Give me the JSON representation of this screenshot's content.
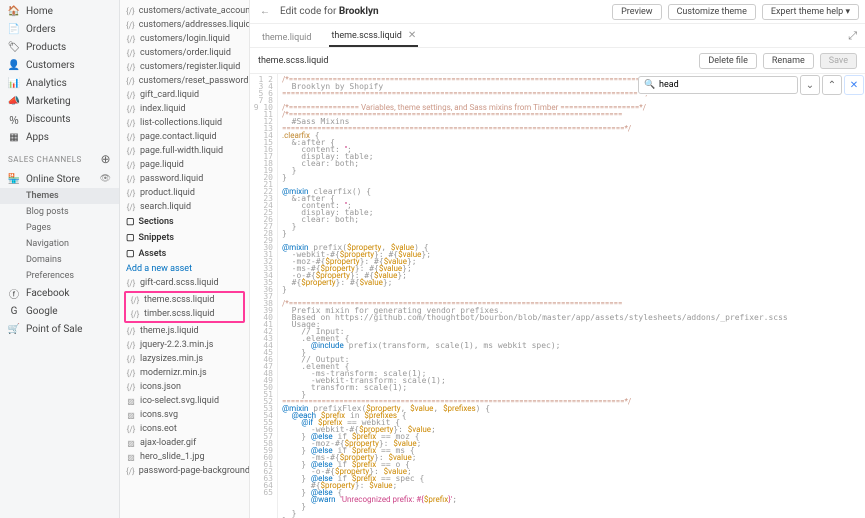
{
  "topbar": {
    "title_prefix": "Edit code for ",
    "title_store": "Brooklyn",
    "preview": "Preview",
    "customize": "Customize theme",
    "expert_help": "Expert theme help"
  },
  "nav": {
    "main": [
      {
        "icon": "home",
        "label": "Home"
      },
      {
        "icon": "orders",
        "label": "Orders"
      },
      {
        "icon": "products",
        "label": "Products"
      },
      {
        "icon": "customers",
        "label": "Customers"
      },
      {
        "icon": "analytics",
        "label": "Analytics"
      },
      {
        "icon": "marketing",
        "label": "Marketing"
      },
      {
        "icon": "discounts",
        "label": "Discounts"
      },
      {
        "icon": "apps",
        "label": "Apps"
      }
    ],
    "channels_head": "SALES CHANNELS",
    "online_store": "Online Store",
    "online_sub": [
      "Themes",
      "Blog posts",
      "Pages",
      "Navigation",
      "Domains",
      "Preferences"
    ],
    "extra": [
      {
        "icon": "fb",
        "label": "Facebook"
      },
      {
        "icon": "google",
        "label": "Google"
      },
      {
        "icon": "pos",
        "label": "Point of Sale"
      }
    ]
  },
  "tree": {
    "top_files": [
      "customers/activate_account...",
      "customers/addresses.liquid",
      "customers/login.liquid",
      "customers/order.liquid",
      "customers/register.liquid",
      "customers/reset_password.li",
      "gift_card.liquid",
      "index.liquid",
      "list-collections.liquid",
      "page.contact.liquid",
      "page.full-width.liquid",
      "page.liquid",
      "password.liquid",
      "product.liquid",
      "search.liquid"
    ],
    "sections": "Sections",
    "snippets": "Snippets",
    "assets": "Assets",
    "add_asset": "Add a new asset",
    "asset_files_pre": [
      "gift-card.scss.liquid"
    ],
    "highlighted": [
      "theme.scss.liquid",
      "timber.scss.liquid"
    ],
    "asset_files_post": [
      "theme.js.liquid",
      "jquery-2.2.3.min.js",
      "lazysizes.min.js",
      "modernizr.min.js",
      "icons.json",
      "ico-select.svg.liquid",
      "icons.svg",
      "icons.eot",
      "ajax-loader.gif",
      "hero_slide_1.jpg",
      "password-page-background"
    ]
  },
  "tabs": {
    "tab1": "theme.liquid",
    "tab2": "theme.scss.liquid"
  },
  "filebar": {
    "filename": "theme.scss.liquid",
    "delete": "Delete file",
    "rename": "Rename",
    "save": "Save"
  },
  "search": {
    "value": "head"
  },
  "code_lines": [
    "/*================================================================================",
    "  Brooklyn by Shopify",
    "==================================================================================*/",
    "",
    "/*================ Variables, theme settings, and Sass mixins from Timber ==================*/",
    "/*============================================================================",
    "  #Sass Mixins",
    "==============================================================================*/",
    ".clearfix {",
    "  &:after {",
    "    content: '';",
    "    display: table;",
    "    clear: both;",
    "  }",
    "}",
    "",
    "@mixin clearfix() {",
    "  &:after {",
    "    content: '';",
    "    display: table;",
    "    clear: both;",
    "  }",
    "}",
    "",
    "@mixin prefix($property, $value) {",
    "  -webkit-#{$property}: #{$value};",
    "  -moz-#{$property}: #{$value};",
    "  -ms-#{$property}: #{$value};",
    "  -o-#{$property}: #{$value};",
    "  #{$property}: #{$value};",
    "}",
    "",
    "/*============================================================================",
    "  Prefix mixin for generating vendor prefixes.",
    "  Based on https://github.com/thoughtbot/bourbon/blob/master/app/assets/stylesheets/addons/_prefixer.scss",
    "  Usage:",
    "    // Input:",
    "    .element {",
    "      @include prefix(transform, scale(1), ms webkit spec);",
    "    }",
    "    // Output:",
    "    .element {",
    "      -ms-transform: scale(1);",
    "      -webkit-transform: scale(1);",
    "      transform: scale(1);",
    "    }",
    "==============================================================================*/",
    "@mixin prefixFlex($property, $value, $prefixes) {",
    "  @each $prefix in $prefixes {",
    "    @if $prefix == webkit {",
    "      -webkit-#{$property}: $value;",
    "    } @else if $prefix == moz {",
    "      -moz-#{$property}: $value;",
    "    } @else if $prefix == ms {",
    "      -ms-#{$property}: $value;",
    "    } @else if $prefix == o {",
    "      -o-#{$property}: $value;",
    "    } @else if $prefix == spec {",
    "      #{$property}: $value;",
    "    } @else {",
    "      @warn 'Unrecognized prefix: #{$prefix}';",
    "    }",
    "  }",
    "}",
    ""
  ]
}
